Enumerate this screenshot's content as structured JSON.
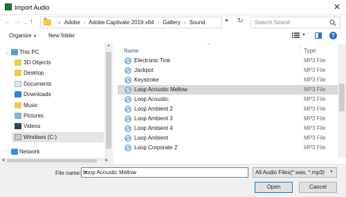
{
  "window": {
    "title": "Import Audio",
    "close_label": "✕"
  },
  "nav": {
    "back": "←",
    "forward": "→",
    "recent": "⌄",
    "up": "↑",
    "breadcrumbs": [
      "Adobe",
      "Adobe Captivate 2019 x64",
      "Gallery",
      "Sound"
    ],
    "crumb_prefix": "«",
    "separator": "›",
    "search_placeholder": "Search Sound"
  },
  "toolbar": {
    "organize": "Organize",
    "new_folder": "New folder"
  },
  "sidebar": {
    "this_pc": "This PC",
    "items": [
      "3D Objects",
      "Desktop",
      "Documents",
      "Downloads",
      "Music",
      "Pictures",
      "Videos",
      "Windows (C:)"
    ],
    "network": "Network"
  },
  "columns": {
    "name": "Name",
    "type": "Type"
  },
  "files": [
    {
      "name": "Electronic Tink",
      "type": "MP3 File"
    },
    {
      "name": "Jackpot",
      "type": "MP3 File"
    },
    {
      "name": "Keystroke",
      "type": "MP3 File"
    },
    {
      "name": "Loop Acoustic Mellow",
      "type": "MP3 File"
    },
    {
      "name": "Loop Acoustic",
      "type": "MP3 File"
    },
    {
      "name": "Loop Ambient 2",
      "type": "MP3 File"
    },
    {
      "name": "Loop Ambient 3",
      "type": "MP3 File"
    },
    {
      "name": "Loop Ambient 4",
      "type": "MP3 File"
    },
    {
      "name": "Loop Ambient",
      "type": "MP3 File"
    },
    {
      "name": "Loop Corporate 2",
      "type": "MP3 File"
    }
  ],
  "selected_file": "Loop Acoustic Mellow",
  "bottom": {
    "file_name_label": "File name:",
    "file_name_value": "Loop Acoustic Mellow",
    "filter": "All Audio Files(*.wav, *.mp3)",
    "open_label": "Open",
    "cancel_label": "Cancel"
  },
  "colors": {
    "accent": "#0078d7",
    "selected_row": "#d9d9d9"
  }
}
